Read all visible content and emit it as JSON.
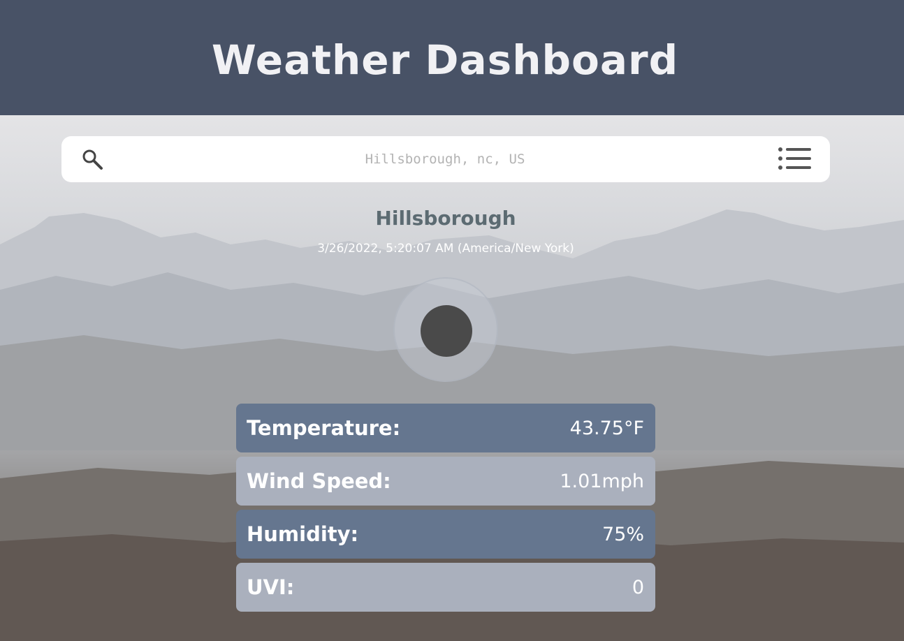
{
  "header": {
    "title": "Weather Dashboard"
  },
  "search": {
    "placeholder": "Hillsborough, nc, US",
    "value": ""
  },
  "icons": {
    "search": "search-icon",
    "menu": "list-menu-icon",
    "weather": "weather-condition-icon"
  },
  "location": {
    "city": "Hillsborough",
    "datetime": "3/26/2022, 5:20:07 AM (America/New York)"
  },
  "stats": [
    {
      "label": "Temperature:",
      "value": "43.75°F"
    },
    {
      "label": "Wind Speed:",
      "value": "1.01mph"
    },
    {
      "label": "Humidity:",
      "value": "75%"
    },
    {
      "label": "UVI:",
      "value": "0"
    }
  ],
  "colors": {
    "header_bg": "#485266",
    "row_dark": "#65768f",
    "row_light": "#aab0bd",
    "city_text": "#5c6b72"
  }
}
